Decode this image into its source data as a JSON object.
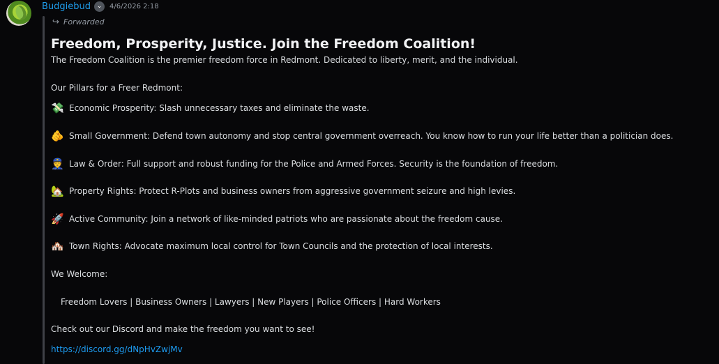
{
  "author": {
    "name": "Budgiebud",
    "badge_icon": "chevron-down-icon",
    "timestamp": "4/6/2026 2:18"
  },
  "forwarded": {
    "icon": "forward-arrow-icon",
    "label": "Forwarded"
  },
  "message": {
    "headline": "Freedom, Prosperity, Justice. Join the Freedom Coalition!",
    "intro": "The Freedom Coalition is the premier freedom force in Redmont. Dedicated to liberty, merit, and the individual.",
    "pillars_heading": "Our Pillars for a Freer Redmont:",
    "pillars": [
      {
        "emoji": "💸",
        "icon": "money-with-wings-icon",
        "text": "Economic Prosperity: Slash unnecessary taxes and eliminate the waste."
      },
      {
        "emoji": "🫵",
        "icon": "pointing-hand-icon",
        "text": "Small Government: Defend town autonomy and stop central government overreach. You know how to run your life better than a politician does."
      },
      {
        "emoji": "👮",
        "icon": "police-officer-icon",
        "text": "Law & Order: Full support and robust funding for the Police and Armed Forces. Security is the foundation of freedom."
      },
      {
        "emoji": "🏡",
        "icon": "house-with-garden-icon",
        "text": "Property Rights: Protect R-Plots and business owners from aggressive government seizure and high levies."
      },
      {
        "emoji": "🚀",
        "icon": "rocket-icon",
        "text": "Active Community: Join a network of like-minded patriots who are passionate about the freedom cause."
      },
      {
        "emoji": "🏘️",
        "icon": "houses-icon",
        "text": "Town Rights: Advocate maximum local control for Town Councils and the protection of local interests."
      }
    ],
    "welcome_heading": "We Welcome:",
    "welcome_list": "Freedom Lovers | Business Owners | Lawyers | New Players | Police Officers | Hard Workers",
    "cta": "Check out our Discord and make the freedom you want to see!",
    "link": "https://discord.gg/dNpHvZwjMv"
  },
  "colors": {
    "background": "#070709",
    "username": "#1e9be9",
    "link": "#1d9bf0",
    "text": "#dbdee1",
    "muted": "#949ba4"
  }
}
